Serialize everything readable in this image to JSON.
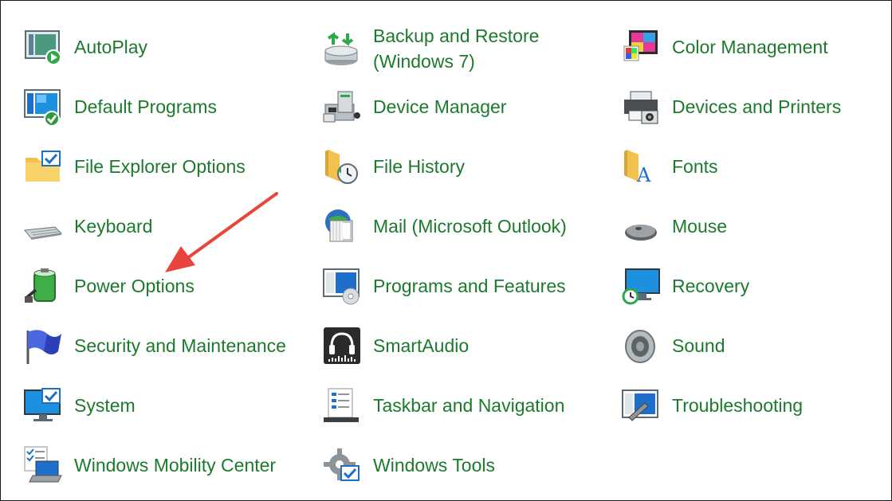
{
  "applets": [
    {
      "label": "AutoPlay",
      "icon": "autoplay-icon"
    },
    {
      "label": "Backup and Restore (Windows 7)",
      "icon": "backup-restore-icon"
    },
    {
      "label": "Color Management",
      "icon": "color-management-icon"
    },
    {
      "label": "Default Programs",
      "icon": "default-programs-icon"
    },
    {
      "label": "Device Manager",
      "icon": "device-manager-icon"
    },
    {
      "label": "Devices and Printers",
      "icon": "devices-printers-icon"
    },
    {
      "label": "File Explorer Options",
      "icon": "file-explorer-options-icon"
    },
    {
      "label": "File History",
      "icon": "file-history-icon"
    },
    {
      "label": "Fonts",
      "icon": "fonts-icon"
    },
    {
      "label": "Keyboard",
      "icon": "keyboard-icon"
    },
    {
      "label": "Mail (Microsoft Outlook)",
      "icon": "mail-icon"
    },
    {
      "label": "Mouse",
      "icon": "mouse-icon"
    },
    {
      "label": "Power Options",
      "icon": "power-options-icon"
    },
    {
      "label": "Programs and Features",
      "icon": "programs-features-icon"
    },
    {
      "label": "Recovery",
      "icon": "recovery-icon"
    },
    {
      "label": "Security and Maintenance",
      "icon": "security-maintenance-icon"
    },
    {
      "label": "SmartAudio",
      "icon": "smartaudio-icon"
    },
    {
      "label": "Sound",
      "icon": "sound-icon"
    },
    {
      "label": "System",
      "icon": "system-icon"
    },
    {
      "label": "Taskbar and Navigation",
      "icon": "taskbar-navigation-icon"
    },
    {
      "label": "Troubleshooting",
      "icon": "troubleshooting-icon"
    },
    {
      "label": "Windows Mobility Center",
      "icon": "mobility-center-icon"
    },
    {
      "label": "Windows Tools",
      "icon": "windows-tools-icon"
    }
  ],
  "colors": {
    "link": "#1c7a2c",
    "annotation_arrow": "#e8453c",
    "border": "#1a1a1a"
  },
  "annotation": {
    "icon": "arrow-icon",
    "points_to": "Power Options"
  }
}
